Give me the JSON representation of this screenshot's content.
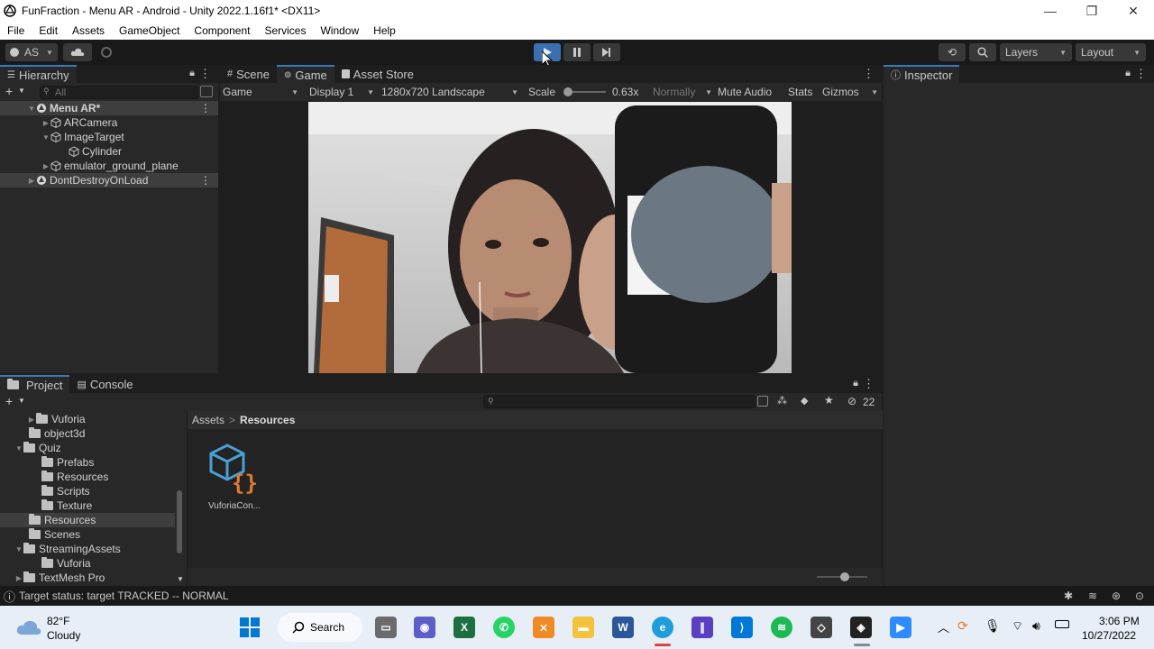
{
  "window": {
    "title": "FunFraction - Menu AR - Android - Unity 2022.1.16f1* <DX11>",
    "min_label": "—",
    "max_label": "❐",
    "close_label": "✕"
  },
  "menu": [
    "File",
    "Edit",
    "Assets",
    "GameObject",
    "Component",
    "Services",
    "Window",
    "Help"
  ],
  "toolbar": {
    "account": "AS",
    "layers": "Layers",
    "layout": "Layout"
  },
  "hierarchy": {
    "tab": "Hierarchy",
    "search_placeholder": "All",
    "items": [
      {
        "label": "Menu AR*",
        "indent": 0
      },
      {
        "label": "ARCamera",
        "indent": 1
      },
      {
        "label": "ImageTarget",
        "indent": 1
      },
      {
        "label": "Cylinder",
        "indent": 2
      },
      {
        "label": "emulator_ground_plane",
        "indent": 1
      },
      {
        "label": "DontDestroyOnLoad",
        "indent": 0
      }
    ]
  },
  "scene_tabs": [
    "Scene",
    "Game",
    "Asset Store"
  ],
  "game_bar": {
    "mode": "Game",
    "display": "Display 1",
    "resolution": "1280x720 Landscape",
    "scale_label": "Scale",
    "scale_value": "0.63x",
    "play_focus": "Normally",
    "mute": "Mute Audio",
    "stats": "Stats",
    "gizmos": "Gizmos"
  },
  "inspector": {
    "tab": "Inspector"
  },
  "project": {
    "tabs": [
      "Project",
      "Console"
    ],
    "hidden_count": "22",
    "breadcrumb": [
      "Assets",
      "Resources"
    ],
    "tree": [
      {
        "label": "Vuforia",
        "indent": 2
      },
      {
        "label": "object3d",
        "indent": 1
      },
      {
        "label": "Quiz",
        "indent": 1
      },
      {
        "label": "Prefabs",
        "indent": 2
      },
      {
        "label": "Resources",
        "indent": 2
      },
      {
        "label": "Scripts",
        "indent": 2
      },
      {
        "label": "Texture",
        "indent": 2
      },
      {
        "label": "Resources",
        "indent": 1
      },
      {
        "label": "Scenes",
        "indent": 1
      },
      {
        "label": "StreamingAssets",
        "indent": 1
      },
      {
        "label": "Vuforia",
        "indent": 2
      },
      {
        "label": "TextMesh Pro",
        "indent": 1
      }
    ],
    "asset_name": "VuforiaCon..."
  },
  "status": {
    "text": "Target status: target TRACKED -- NORMAL"
  },
  "taskbar": {
    "temperature": "82°F",
    "weather": "Cloudy",
    "search": "Search",
    "time": "3:06 PM",
    "date": "10/27/2022"
  }
}
